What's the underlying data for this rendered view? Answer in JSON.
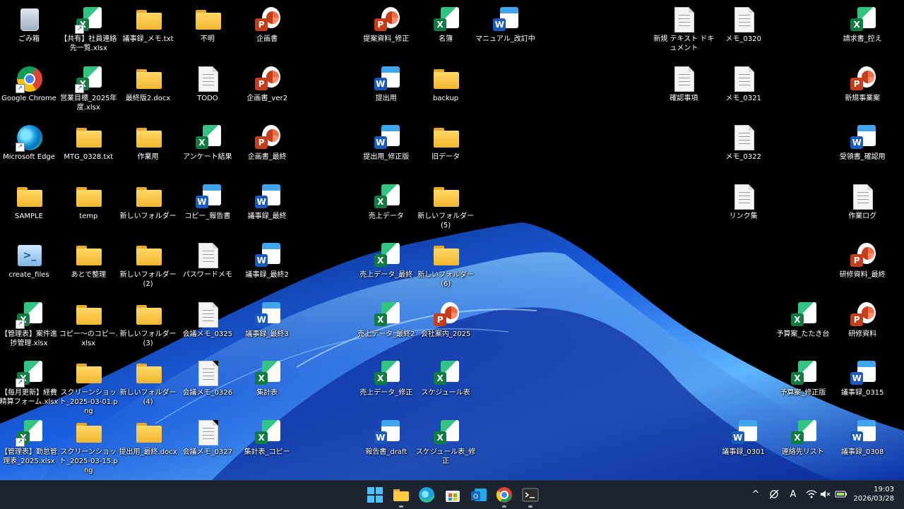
{
  "desktop": {
    "icons": [
      {
        "label": "ごみ箱",
        "type": "recycle",
        "col": 0,
        "row": 0
      },
      {
        "label": "Google Chrome",
        "type": "chrome",
        "col": 0,
        "row": 1
      },
      {
        "label": "Microsoft Edge",
        "type": "edge",
        "col": 0,
        "row": 2
      },
      {
        "label": "SAMPLE",
        "type": "folder",
        "col": 0,
        "row": 3
      },
      {
        "label": "create_files",
        "type": "ps",
        "col": 0,
        "row": 4
      },
      {
        "label": "【管理表】案件進捗管理.xlsx",
        "type": "xl",
        "shortcut": true,
        "col": 0,
        "row": 5
      },
      {
        "label": "【毎月更新】経費精算フォーム.xlsx",
        "type": "xl",
        "shortcut": true,
        "col": 0,
        "row": 6
      },
      {
        "label": "【管理表】勤怠管理表_2025.xlsx",
        "type": "xl",
        "shortcut": true,
        "col": 0,
        "row": 7
      },
      {
        "label": "【共有】社員連絡先一覧.xlsx",
        "type": "xl",
        "shortcut": true,
        "col": 1,
        "row": 0
      },
      {
        "label": "営業目標_2025年度.xlsx",
        "type": "xl",
        "shortcut": true,
        "col": 1,
        "row": 1
      },
      {
        "label": "MTG_0328.txt",
        "type": "folder",
        "col": 1,
        "row": 2
      },
      {
        "label": "temp",
        "type": "folder",
        "col": 1,
        "row": 3
      },
      {
        "label": "あとで整理",
        "type": "folder",
        "col": 1,
        "row": 4
      },
      {
        "label": "コピー～のコピー.xlsx",
        "type": "folder",
        "col": 1,
        "row": 5
      },
      {
        "label": "スクリーンショット_2025-03-01.png",
        "type": "folder",
        "col": 1,
        "row": 6
      },
      {
        "label": "スクリーンショット_2025-03-15.png",
        "type": "folder",
        "col": 1,
        "row": 7
      },
      {
        "label": "議事録_メモ.txt",
        "type": "folder",
        "col": 2,
        "row": 0
      },
      {
        "label": "最終版2.docx",
        "type": "folder",
        "col": 2,
        "row": 1
      },
      {
        "label": "作業用",
        "type": "folder",
        "col": 2,
        "row": 2
      },
      {
        "label": "新しいフォルダー",
        "type": "folder",
        "col": 2,
        "row": 3
      },
      {
        "label": "新しいフォルダー(2)",
        "type": "folder",
        "col": 2,
        "row": 4
      },
      {
        "label": "新しいフォルダー(3)",
        "type": "folder",
        "col": 2,
        "row": 5
      },
      {
        "label": "新しいフォルダー(4)",
        "type": "folder",
        "col": 2,
        "row": 6
      },
      {
        "label": "提出用_最終.docx",
        "type": "folder",
        "col": 2,
        "row": 7
      },
      {
        "label": "不明",
        "type": "folder",
        "col": 3,
        "row": 0
      },
      {
        "label": "TODO",
        "type": "doc",
        "col": 3,
        "row": 1
      },
      {
        "label": "アンケート結果",
        "type": "xl",
        "col": 3,
        "row": 2
      },
      {
        "label": "コピー_報告書",
        "type": "wd",
        "col": 3,
        "row": 3
      },
      {
        "label": "パスワードメモ",
        "type": "doc",
        "col": 3,
        "row": 4
      },
      {
        "label": "会議メモ_0325",
        "type": "doc",
        "col": 3,
        "row": 5
      },
      {
        "label": "会議メモ_0326",
        "type": "doc",
        "col": 3,
        "row": 6
      },
      {
        "label": "会議メモ_0327",
        "type": "doc",
        "col": 3,
        "row": 7
      },
      {
        "label": "企画書",
        "type": "pp",
        "col": 4,
        "row": 0
      },
      {
        "label": "企画書_ver2",
        "type": "pp",
        "col": 4,
        "row": 1
      },
      {
        "label": "企画書_最終",
        "type": "pp",
        "col": 4,
        "row": 2
      },
      {
        "label": "議事録_最終",
        "type": "wd",
        "col": 4,
        "row": 3
      },
      {
        "label": "議事録_最終2",
        "type": "wd",
        "col": 4,
        "row": 4
      },
      {
        "label": "議事録_最終3",
        "type": "wd",
        "col": 4,
        "row": 5
      },
      {
        "label": "集計表",
        "type": "xl",
        "col": 4,
        "row": 6
      },
      {
        "label": "集計表_コピー",
        "type": "xl",
        "col": 4,
        "row": 7
      },
      {
        "label": "提案資料_修正",
        "type": "pp",
        "col": 6,
        "row": 0
      },
      {
        "label": "提出用",
        "type": "wd",
        "col": 6,
        "row": 1
      },
      {
        "label": "提出用_修正版",
        "type": "wd",
        "col": 6,
        "row": 2
      },
      {
        "label": "売上データ",
        "type": "xl",
        "col": 6,
        "row": 3
      },
      {
        "label": "売上データ_最終",
        "type": "xl",
        "col": 6,
        "row": 4
      },
      {
        "label": "売上データ_最終2",
        "type": "xl",
        "col": 6,
        "row": 5
      },
      {
        "label": "売上データ_修正",
        "type": "xl",
        "col": 6,
        "row": 6
      },
      {
        "label": "報告書_draft",
        "type": "wd",
        "col": 6,
        "row": 7
      },
      {
        "label": "名簿",
        "type": "xl",
        "col": 7,
        "row": 0
      },
      {
        "label": "backup",
        "type": "folder",
        "col": 7,
        "row": 1
      },
      {
        "label": "旧データ",
        "type": "folder",
        "col": 7,
        "row": 2
      },
      {
        "label": "新しいフォルダー(5)",
        "type": "folder",
        "col": 7,
        "row": 3
      },
      {
        "label": "新しいフォルダー(6)",
        "type": "folder",
        "col": 7,
        "row": 4
      },
      {
        "label": "会社案内_2025",
        "type": "pp",
        "col": 7,
        "row": 5
      },
      {
        "label": "スケジュール表",
        "type": "xl",
        "col": 7,
        "row": 6
      },
      {
        "label": "スケジュール表_修正",
        "type": "xl",
        "col": 7,
        "row": 7
      },
      {
        "label": "マニュアル_改訂中",
        "type": "wd",
        "col": 8,
        "row": 0
      },
      {
        "label": "新規 テキスト ドキュメント",
        "type": "doc",
        "col": 11,
        "row": 0
      },
      {
        "label": "確認事項",
        "type": "doc",
        "col": 11,
        "row": 1
      },
      {
        "label": "メモ_0320",
        "type": "doc",
        "col": 12,
        "row": 0
      },
      {
        "label": "メモ_0321",
        "type": "doc",
        "col": 12,
        "row": 1
      },
      {
        "label": "メモ_0322",
        "type": "doc",
        "col": 12,
        "row": 2
      },
      {
        "label": "リンク集",
        "type": "doc",
        "col": 12,
        "row": 3
      },
      {
        "label": "議事録_0301",
        "type": "wd",
        "col": 12,
        "row": 7
      },
      {
        "label": "予算案_たたき台",
        "type": "xl",
        "col": 13,
        "row": 5
      },
      {
        "label": "予算案_修正版",
        "type": "xl",
        "col": 13,
        "row": 6
      },
      {
        "label": "連絡先リスト",
        "type": "xl",
        "col": 13,
        "row": 7
      },
      {
        "label": "請求書_控え",
        "type": "xl",
        "col": 14,
        "row": 0
      },
      {
        "label": "新規事業案",
        "type": "pp",
        "col": 14,
        "row": 1
      },
      {
        "label": "受領書_確認用",
        "type": "wd",
        "col": 14,
        "row": 2
      },
      {
        "label": "作業ログ",
        "type": "doc",
        "col": 14,
        "row": 3
      },
      {
        "label": "研修資料_最終",
        "type": "pp",
        "col": 14,
        "row": 4
      },
      {
        "label": "研修資料",
        "type": "pp",
        "col": 14,
        "row": 5
      },
      {
        "label": "議事録_0315",
        "type": "wd",
        "col": 14,
        "row": 6
      },
      {
        "label": "議事録_0308",
        "type": "wd",
        "col": 14,
        "row": 7
      }
    ]
  },
  "taskbar": {
    "apps": [
      {
        "name": "start-button",
        "icon": "windows-logo-icon",
        "running": false
      },
      {
        "name": "file-explorer-button",
        "icon": "folder-icon",
        "running": true
      },
      {
        "name": "edge-button",
        "icon": "edge-icon",
        "running": false
      },
      {
        "name": "store-button",
        "icon": "store-icon",
        "running": false
      },
      {
        "name": "outlook-button",
        "icon": "outlook-icon",
        "running": false
      },
      {
        "name": "chrome-button",
        "icon": "chrome-icon",
        "running": true
      },
      {
        "name": "terminal-button",
        "icon": "terminal-icon",
        "running": true
      }
    ],
    "tray": {
      "chevron": "^",
      "ime": "A",
      "time": "19:03",
      "date": "2026/03/28"
    }
  },
  "colors": {
    "taskbar": "#1c2430",
    "folder": "#f2b62f",
    "excel": "#107c41",
    "word": "#185abd",
    "powerpoint": "#c43e1c"
  }
}
